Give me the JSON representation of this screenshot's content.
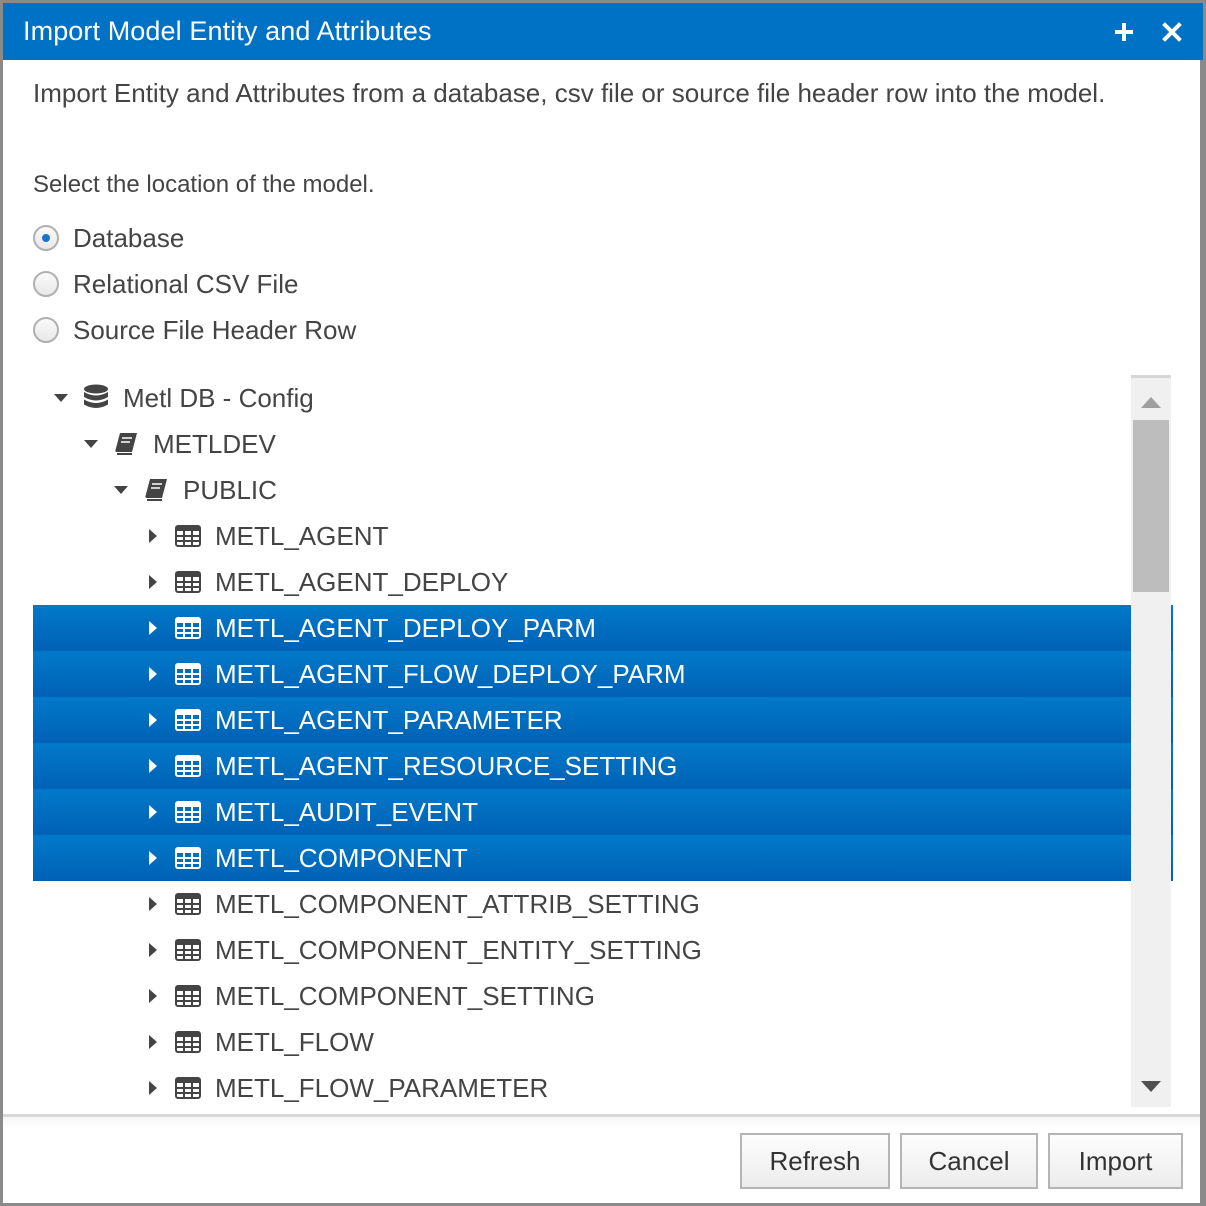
{
  "dialog": {
    "title": "Import Model Entity and Attributes",
    "maximize_icon": "plus-icon",
    "close_icon": "close-icon",
    "description": "Import Entity and Attributes from a database, csv file or source file header row into the model.",
    "location_prompt": "Select the location of the model."
  },
  "location_options": [
    {
      "label": "Database",
      "checked": true
    },
    {
      "label": "Relational CSV File",
      "checked": false
    },
    {
      "label": "Source File Header Row",
      "checked": false
    }
  ],
  "tree": {
    "root": {
      "label": "Metl DB - Config",
      "icon": "database-icon",
      "expanded": true
    },
    "catalog": {
      "label": "METLDEV",
      "icon": "book-icon",
      "expanded": true
    },
    "schema": {
      "label": "PUBLIC",
      "icon": "book-icon",
      "expanded": true
    },
    "tables": [
      {
        "label": "METL_AGENT",
        "selected": false
      },
      {
        "label": "METL_AGENT_DEPLOY",
        "selected": false
      },
      {
        "label": "METL_AGENT_DEPLOY_PARM",
        "selected": true
      },
      {
        "label": "METL_AGENT_FLOW_DEPLOY_PARM",
        "selected": true
      },
      {
        "label": "METL_AGENT_PARAMETER",
        "selected": true
      },
      {
        "label": "METL_AGENT_RESOURCE_SETTING",
        "selected": true
      },
      {
        "label": "METL_AUDIT_EVENT",
        "selected": true
      },
      {
        "label": "METL_COMPONENT",
        "selected": true
      },
      {
        "label": "METL_COMPONENT_ATTRIB_SETTING",
        "selected": false
      },
      {
        "label": "METL_COMPONENT_ENTITY_SETTING",
        "selected": false
      },
      {
        "label": "METL_COMPONENT_SETTING",
        "selected": false
      },
      {
        "label": "METL_FLOW",
        "selected": false
      },
      {
        "label": "METL_FLOW_PARAMETER",
        "selected": false
      }
    ]
  },
  "buttons": {
    "refresh": "Refresh",
    "cancel": "Cancel",
    "import": "Import"
  },
  "colors": {
    "accent": "#0072c6",
    "selection_top": "#0279c9",
    "selection_bottom": "#0061b5"
  }
}
